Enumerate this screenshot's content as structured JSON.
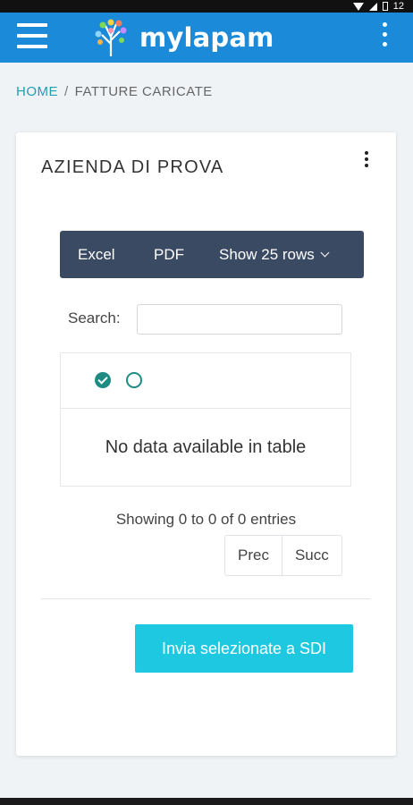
{
  "status_bar": {
    "time": "12"
  },
  "app_bar": {
    "brand": "mylapam",
    "brand_icon": "tree-logo-icon",
    "menu_icon": "hamburger-icon",
    "more_icon": "kebab-icon"
  },
  "breadcrumb": {
    "home": "HOME",
    "separator": "/",
    "current": "FATTURE CARICATE"
  },
  "card": {
    "title": "AZIENDA DI PROVA",
    "toolbar": {
      "excel": "Excel",
      "pdf": "PDF",
      "rows": "Show 25 rows"
    },
    "search": {
      "label": "Search:",
      "value": ""
    },
    "table": {
      "empty_message": "No data available in table"
    },
    "info": "Showing 0 to 0 of 0 entries",
    "pager": {
      "prev": "Prec",
      "next": "Succ"
    },
    "submit": "Invia selezionate a SDI"
  },
  "colors": {
    "app_bar": "#1b8ad9",
    "accent": "#1f9fb0",
    "toolbar": "#3b4a63",
    "button": "#1ec8e0",
    "check": "#1f8c84"
  }
}
